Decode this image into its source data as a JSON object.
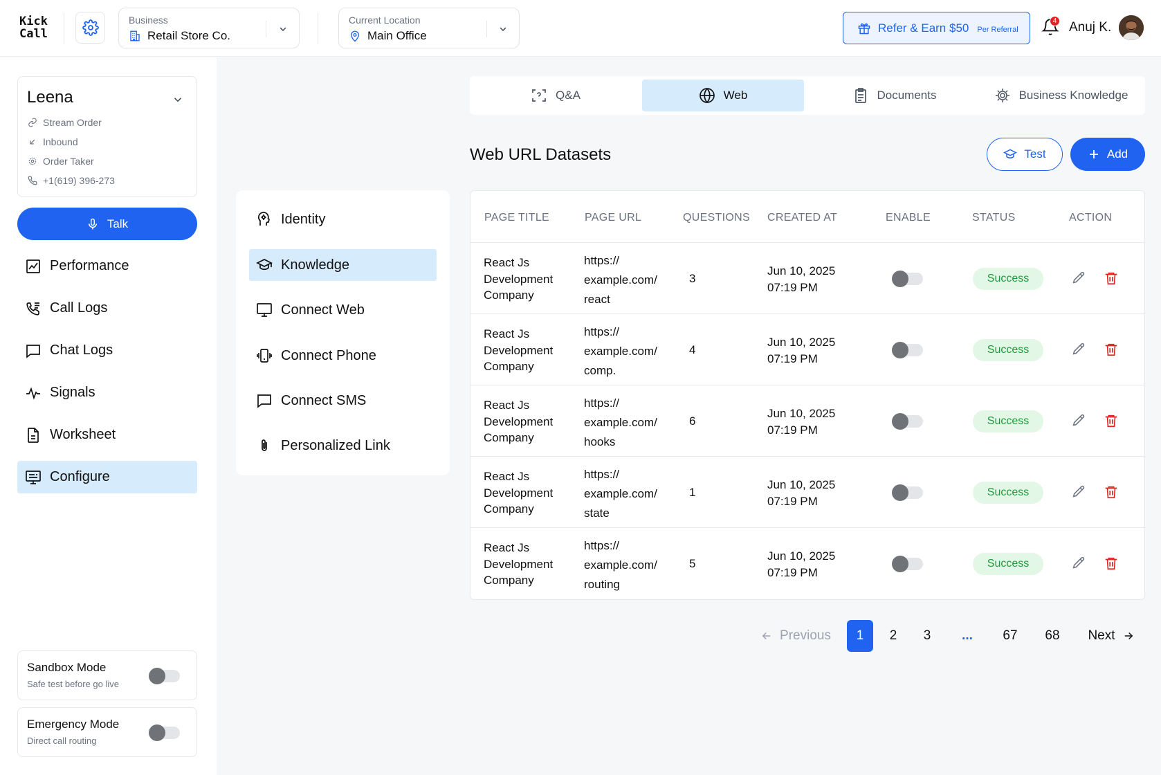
{
  "app": {
    "logo_line1": "Kick",
    "logo_line2": "Call"
  },
  "header": {
    "business_label": "Business",
    "business_value": "Retail Store Co.",
    "location_label": "Current Location",
    "location_value": "Main Office",
    "refer_label": "Refer & Earn $50",
    "refer_sub": "Per Referral",
    "notification_count": "4",
    "user_name": "Anuj K."
  },
  "agent": {
    "name": "Leena",
    "meta": [
      "Stream Order",
      "Inbound",
      "Order Taker",
      "+1(619) 396-273"
    ],
    "talk_label": "Talk"
  },
  "sidebar": {
    "items": [
      {
        "label": "Performance",
        "icon": "chart-icon"
      },
      {
        "label": "Call Logs",
        "icon": "phone-log-icon"
      },
      {
        "label": "Chat Logs",
        "icon": "chat-icon"
      },
      {
        "label": "Signals",
        "icon": "pulse-icon"
      },
      {
        "label": "Worksheet",
        "icon": "document-icon"
      },
      {
        "label": "Configure",
        "icon": "monitor-settings-icon",
        "active": true
      }
    ],
    "sandbox": {
      "title": "Sandbox Mode",
      "subtitle": "Safe test before go live"
    },
    "emergency": {
      "title": "Emergency Mode",
      "subtitle": "Direct call routing"
    }
  },
  "subnav": {
    "items": [
      {
        "label": "Identity",
        "icon": "head-gear-icon"
      },
      {
        "label": "Knowledge",
        "icon": "graduation-cap-icon",
        "active": true
      },
      {
        "label": "Connect Web",
        "icon": "monitor-icon"
      },
      {
        "label": "Connect Phone",
        "icon": "vibrating-phone-icon"
      },
      {
        "label": "Connect SMS",
        "icon": "message-icon"
      },
      {
        "label": "Personalized Link",
        "icon": "paperclip-icon"
      }
    ]
  },
  "tabs": [
    {
      "label": "Q&A",
      "icon": "qa-scan-icon"
    },
    {
      "label": "Web",
      "icon": "globe-icon",
      "active": true
    },
    {
      "label": "Documents",
      "icon": "clipboard-icon"
    },
    {
      "label": "Business Knowledge",
      "icon": "gear-badge-icon"
    }
  ],
  "section": {
    "title": "Web URL Datasets",
    "test_label": "Test",
    "add_label": "Add"
  },
  "table": {
    "headers": [
      "PAGE TITLE",
      "PAGE URL",
      "QUESTIONS",
      "CREATED AT",
      "ENABLE",
      "STATUS",
      "ACTION"
    ],
    "rows": [
      {
        "title": [
          "React Js",
          "Development",
          "Company"
        ],
        "url": [
          "https://",
          "example.com/",
          "react"
        ],
        "questions": "3",
        "date": "Jun 10, 2025",
        "time": "07:19 PM",
        "enabled": false,
        "status": "Success"
      },
      {
        "title": [
          "React Js",
          "Development",
          "Company"
        ],
        "url": [
          "https://",
          "example.com/",
          "comp."
        ],
        "questions": "4",
        "date": "Jun 10, 2025",
        "time": "07:19 PM",
        "enabled": false,
        "status": "Success"
      },
      {
        "title": [
          "React Js",
          "Development",
          "Company"
        ],
        "url": [
          "https://",
          "example.com/",
          "hooks"
        ],
        "questions": "6",
        "date": "Jun 10, 2025",
        "time": "07:19 PM",
        "enabled": false,
        "status": "Success"
      },
      {
        "title": [
          "React Js",
          "Development",
          "Company"
        ],
        "url": [
          "https://",
          "example.com/",
          "state"
        ],
        "questions": "1",
        "date": "Jun 10, 2025",
        "time": "07:19 PM",
        "enabled": false,
        "status": "Success"
      },
      {
        "title": [
          "React Js",
          "Development",
          "Company"
        ],
        "url": [
          "https://",
          "example.com/",
          "routing"
        ],
        "questions": "5",
        "date": "Jun 10, 2025",
        "time": "07:19 PM",
        "enabled": false,
        "status": "Success"
      }
    ]
  },
  "pagination": {
    "previous": "Previous",
    "next": "Next",
    "pages": [
      "1",
      "2",
      "3",
      "...",
      "67",
      "68"
    ],
    "current": "1"
  },
  "colors": {
    "accent": "#1f63f0",
    "active_bg": "#d6ebfc",
    "success_bg": "#e3f7e6",
    "success_text": "#1e9a3b",
    "danger": "#e02424"
  }
}
